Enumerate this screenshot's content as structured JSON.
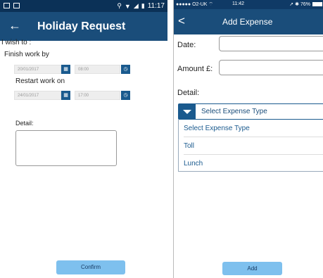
{
  "left_screen": {
    "status_bar": {
      "time": "11:17"
    },
    "app_bar": {
      "back_glyph": "←",
      "title": "Holiday Request"
    },
    "form": {
      "intro": "I wish to :",
      "finish_label": "Finish work by",
      "finish_date": "20/01/2017",
      "finish_time": "08:00",
      "restart_label": "Restart work on",
      "restart_date": "24/01/2017",
      "restart_time": "17:00",
      "detail_label": "Detail:",
      "calendar_glyph": "▦",
      "clock_glyph": "◷"
    },
    "confirm_label": "Confirm"
  },
  "right_screen": {
    "status_bar": {
      "carrier": "●●●●● O2-UK ⌔",
      "time": "11:42",
      "battery": "➚ ✱ 76%"
    },
    "nav_bar": {
      "back_glyph": "<",
      "title": "Add Expense"
    },
    "form": {
      "date_label": "Date:",
      "amount_label": "Amount £:",
      "detail_label": "Detail:",
      "select_label": "Select Expense Type",
      "options": [
        {
          "label": "Select Expense Type"
        },
        {
          "label": "Toll"
        },
        {
          "label": "Lunch"
        }
      ]
    },
    "add_label": "Add"
  },
  "colors": {
    "status_bar": "#0b3157",
    "app_bar": "#1a4d7a",
    "accent": "#1a5a8e",
    "button": "#7ec0ee"
  }
}
